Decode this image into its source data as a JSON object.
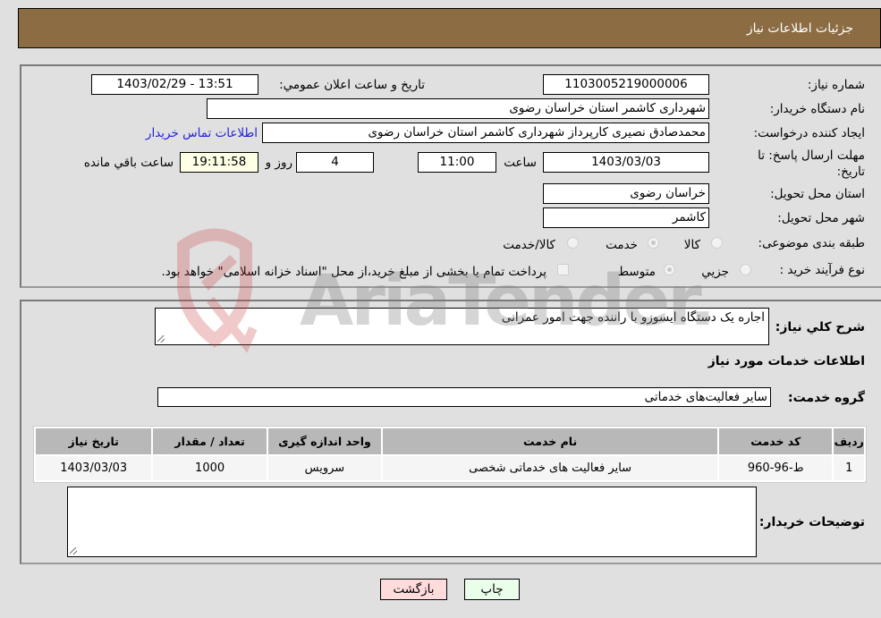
{
  "header": {
    "title": "جزئیات اطلاعات نیاز"
  },
  "details": {
    "need_number_label": "شماره نیاز:",
    "need_number": "1103005219000006",
    "announce_label": "تاریخ و ساعت اعلان عمومي:",
    "announce_value": "1403/02/29 - 13:51",
    "buyer_org_label": "نام دستگاه خریدار:",
    "buyer_org": "شهرداری کاشمر استان خراسان رضوی",
    "creator_label": "ایجاد کننده درخواست:",
    "creator": "محمدصادق نصیری  کارپرداز شهرداری کاشمر استان خراسان رضوی",
    "contact_link": "اطلاعات تماس خریدار",
    "deadline_label_line1": "مهلت ارسال پاسخ: تا",
    "deadline_label_line2": "تاریخ:",
    "deadline_date": "1403/03/03",
    "time_label": "ساعت",
    "deadline_time": "11:00",
    "days_value": "4",
    "days_label": "روز و",
    "remaining_time": "19:11:58",
    "remaining_label": "ساعت باقي مانده",
    "province_label": "استان محل تحویل:",
    "province": "خراسان رضوی",
    "city_label": "شهر محل تحویل:",
    "city": "کاشمر",
    "category_label": "طبقه بندی موضوعی:",
    "category_options": [
      {
        "label": "کالا",
        "checked": false
      },
      {
        "label": "خدمت",
        "checked": true
      },
      {
        "label": "کالا/خدمت",
        "checked": false
      }
    ],
    "process_label": "نوع فرآیند خرید :",
    "process_options": [
      {
        "label": "جزيي",
        "checked": false
      },
      {
        "label": "متوسط",
        "checked": true
      }
    ],
    "treasury_note": "پرداخت تمام یا بخشی از مبلغ خرید،از محل \"اسناد خزانه اسلامی\" خواهد بود.",
    "treasury_checked": false
  },
  "services": {
    "description_label": "شرح كلي نياز:",
    "description": "اجاره یک دستگاه ایسوزو با راننده جهت امور عمرانی",
    "section_title": "اطلاعات خدمات مورد نیاز",
    "group_label": "گروه خدمت:",
    "group_value": "سایر فعالیت‌های خدماتی",
    "table": {
      "headers": [
        "ردیف",
        "کد خدمت",
        "نام خدمت",
        "واحد اندازه گیری",
        "تعداد / مقدار",
        "تاریخ نیاز"
      ],
      "rows": [
        [
          "1",
          "ط-96-960",
          "سایر فعالیت های خدماتی شخصی",
          "سرویس",
          "1000",
          "1403/03/03"
        ]
      ]
    },
    "buyer_notes_label": "توضیحات خریدار:",
    "buyer_notes": ""
  },
  "buttons": {
    "print": "چاپ",
    "back": "بازگشت"
  },
  "colors": {
    "header_bg": "#8c6d43",
    "print_bg": "#eaffea",
    "back_bg": "#ffdcdc",
    "link": "#2323d8"
  },
  "watermark": {
    "text": "AriaTender.neT"
  }
}
